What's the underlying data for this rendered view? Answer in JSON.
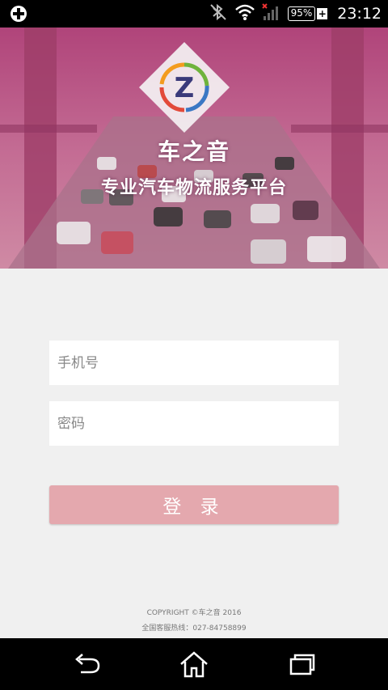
{
  "status_bar": {
    "battery_percent": "95%",
    "battery_plus": "+",
    "time": "23:12",
    "icons": [
      "medical-plus-icon",
      "bluetooth-off-icon",
      "wifi-icon",
      "signal-icon",
      "battery-icon"
    ]
  },
  "banner": {
    "logo_letter": "Z",
    "brand_name": "车之音",
    "tagline": "专业汽车物流服务平台"
  },
  "form": {
    "phone_placeholder": "手机号",
    "password_placeholder": "密码",
    "login_label": "登 录"
  },
  "footer": {
    "copyright": "COPYRIGHT ©车之音 2016",
    "hotline": "全国客服热线：027-84758899"
  },
  "colors": {
    "banner_primary": "#b3487a",
    "login_button": "#e4a8ae",
    "page_background": "#f0f0f0"
  }
}
